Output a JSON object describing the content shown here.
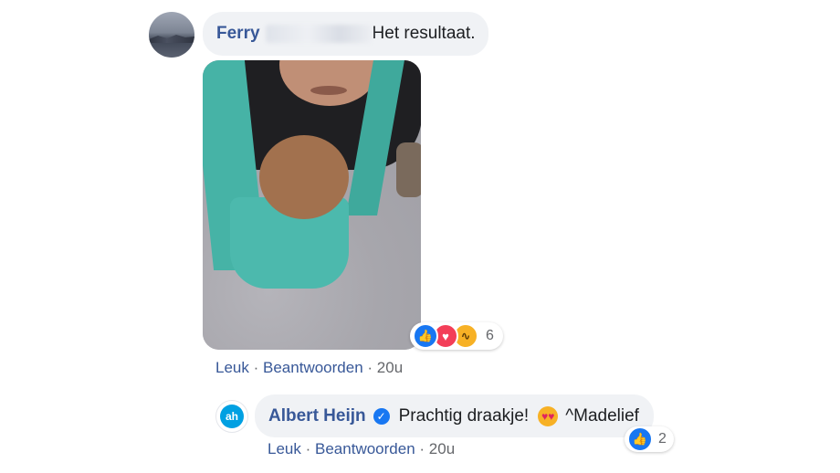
{
  "comment1": {
    "author": "Ferry",
    "text": "Het resultaat.",
    "reactions": {
      "icons": [
        "like-icon",
        "love-icon",
        "haha-icon"
      ],
      "count": "6"
    },
    "actions": {
      "like": "Leuk",
      "reply": "Beantwoorden",
      "time": "20u",
      "separator": "·"
    }
  },
  "reply1": {
    "author": "Albert Heijn",
    "text": "Prachtig draakje!",
    "signature": "^Madelief",
    "reactions": {
      "icons": [
        "like-icon"
      ],
      "count": "2"
    },
    "actions": {
      "like": "Leuk",
      "reply": "Beantwoorden",
      "time": "20u",
      "separator": "·"
    }
  },
  "colors": {
    "link": "#385898",
    "bubble": "#f0f2f5",
    "like": "#1877f2",
    "love": "#f33e58",
    "haha": "#f7b125",
    "ah_blue": "#00a0e2"
  }
}
